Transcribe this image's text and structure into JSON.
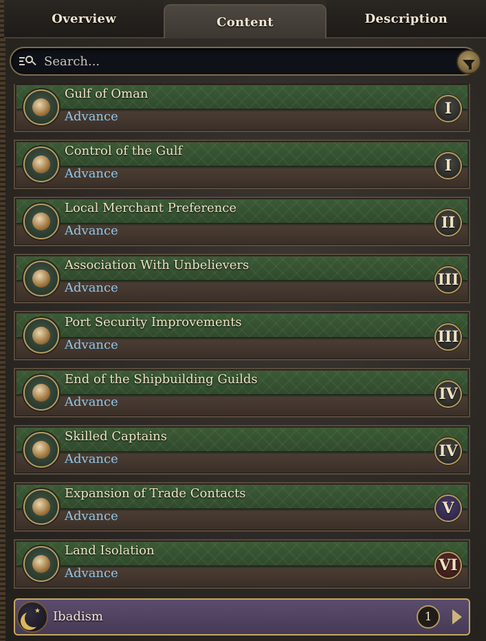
{
  "tabs": [
    {
      "label": "Overview"
    },
    {
      "label": "Content"
    },
    {
      "label": "Description"
    }
  ],
  "search": {
    "placeholder": "Search..."
  },
  "items": [
    {
      "title": "Gulf of Oman",
      "sub": "Advance",
      "tier": "I"
    },
    {
      "title": "Control of the Gulf",
      "sub": "Advance",
      "tier": "I"
    },
    {
      "title": "Local Merchant Preference",
      "sub": "Advance",
      "tier": "II"
    },
    {
      "title": "Association With Unbelievers",
      "sub": "Advance",
      "tier": "III"
    },
    {
      "title": "Port Security Improvements",
      "sub": "Advance",
      "tier": "III"
    },
    {
      "title": "End of the Shipbuilding Guilds",
      "sub": "Advance",
      "tier": "IV"
    },
    {
      "title": "Skilled Captains",
      "sub": "Advance",
      "tier": "IV"
    },
    {
      "title": "Expansion of Trade Contacts",
      "sub": "Advance",
      "tier": "V"
    },
    {
      "title": "Land Isolation",
      "sub": "Advance",
      "tier": "VI"
    }
  ],
  "religion": {
    "name": "Ibadism",
    "count": "1"
  }
}
